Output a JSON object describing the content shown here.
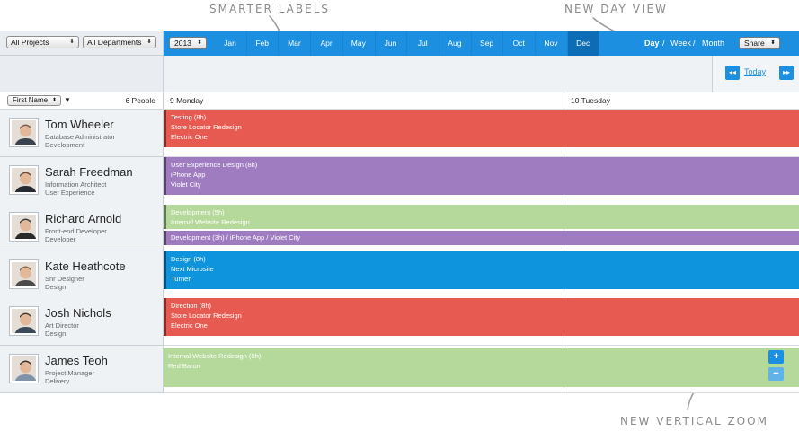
{
  "annotations": {
    "smarter": "SMARTER LABELS",
    "dayview": "NEW DAY VIEW",
    "zoom": "NEW VERTICAL ZOOM"
  },
  "filters": {
    "projects": "All Projects",
    "departments": "All Departments"
  },
  "toolbar": {
    "year": "2013",
    "months": [
      "Jan",
      "Feb",
      "Mar",
      "Apr",
      "May",
      "Jun",
      "Jul",
      "Aug",
      "Sep",
      "Oct",
      "Nov",
      "Dec"
    ],
    "active_month": "Dec",
    "view": {
      "day": "Day",
      "sep1": "/",
      "week": "Week",
      "sep2": "/",
      "month": "Month"
    },
    "share": "Share"
  },
  "nav": {
    "prev": "◂◂",
    "today": "Today",
    "next": "▸▸"
  },
  "header": {
    "sort": "First Name",
    "people": "6 People",
    "day1": "9 Monday",
    "day2": "10 Tuesday"
  },
  "colors": {
    "red": "#e65a51",
    "purple": "#9f7cc0",
    "green": "#b5d99a",
    "blue": "#0e93dd",
    "accent": "#1c8fe0"
  },
  "people": [
    {
      "name": "Tom Wheeler",
      "role": "Database Administrator",
      "dept": "Development",
      "bars": [
        {
          "color": "red",
          "lines": [
            "Testing (8h)",
            "Store Locator Redesign",
            "Electric One"
          ]
        }
      ]
    },
    {
      "name": "Sarah Freedman",
      "role": "Information Architect",
      "dept": "User Experience",
      "bars": [
        {
          "color": "purple",
          "lines": [
            "User Experience Design (8h)",
            "iPhone App",
            "Violet City"
          ]
        }
      ]
    },
    {
      "name": "Richard Arnold",
      "role": "Front-end Developer",
      "dept": "Developer",
      "bars": [
        {
          "color": "green",
          "lines": [
            "Development (5h)",
            "Internal Website Redesign"
          ]
        },
        {
          "color": "purple",
          "lines": [
            "Development (3h) / iPhone App / Violet City"
          ]
        }
      ]
    },
    {
      "name": "Kate Heathcote",
      "role": "Snr Designer",
      "dept": "Design",
      "bars": [
        {
          "color": "blue",
          "lines": [
            "Design (8h)",
            "Next Microsite",
            "Turner"
          ]
        }
      ]
    },
    {
      "name": "Josh Nichols",
      "role": "Art Director",
      "dept": "Design",
      "bars": [
        {
          "color": "red",
          "lines": [
            "Direction (8h)",
            "Store Locator Redesign",
            "Electric One"
          ]
        }
      ]
    },
    {
      "name": "James Teoh",
      "role": "Project Manager",
      "dept": "Delivery",
      "bars": [
        {
          "color": "green",
          "lines": [
            "Internal Website Redesign (8h)",
            "Red Baron"
          ]
        }
      ]
    }
  ],
  "zoom": {
    "plus": "+",
    "minus": "−"
  }
}
